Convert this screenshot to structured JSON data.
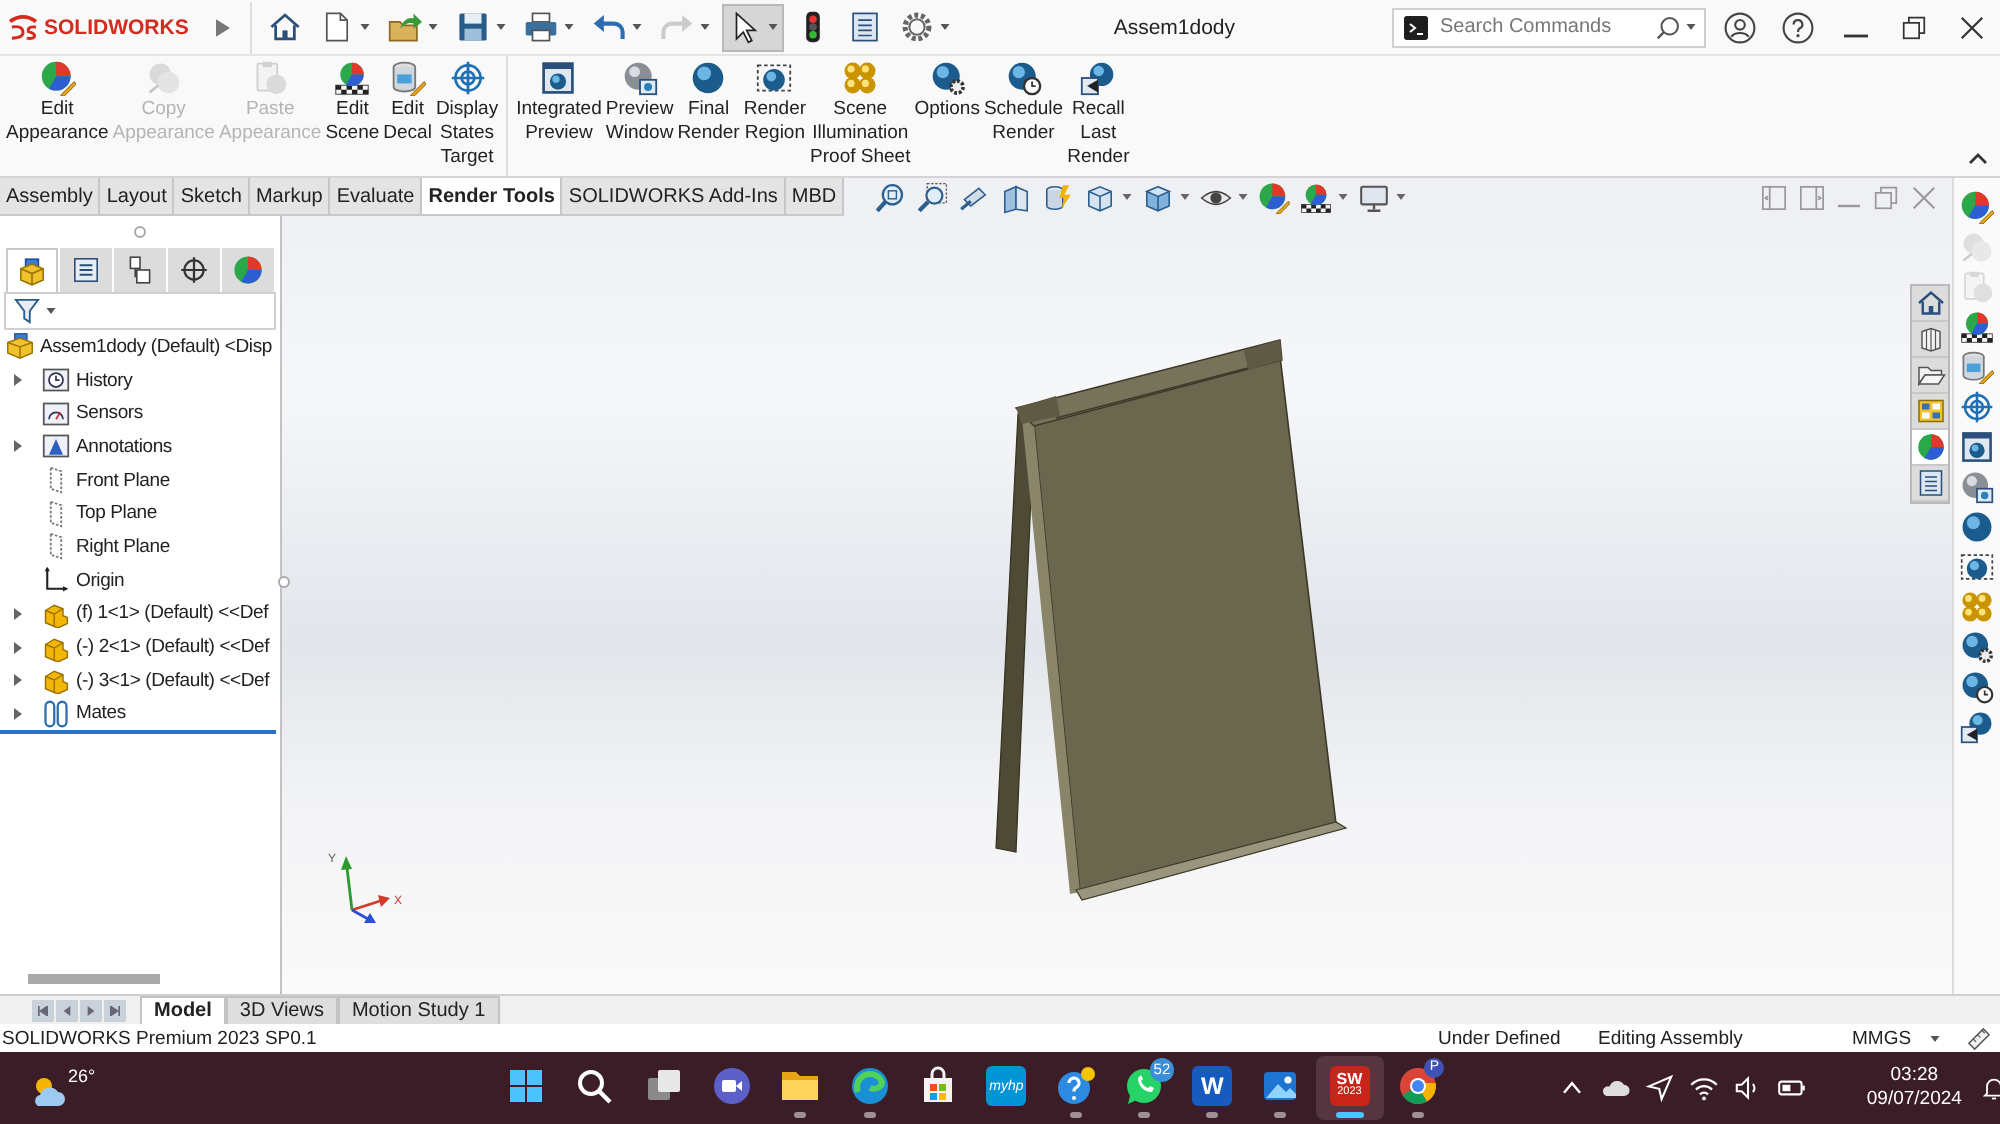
{
  "title_bar": {
    "logo": "SOLIDWORKS",
    "quick_access": [
      {
        "has_menu": false,
        "disabled": false,
        "selected": false
      },
      {
        "has_menu": true,
        "disabled": false,
        "selected": false
      },
      {
        "has_menu": true,
        "disabled": false,
        "selected": false
      },
      {
        "has_menu": true,
        "disabled": false,
        "selected": false
      },
      {
        "has_menu": true,
        "disabled": false,
        "selected": false
      },
      {
        "has_menu": true,
        "disabled": false,
        "selected": false
      },
      {
        "has_menu": true,
        "disabled": true,
        "selected": false
      },
      {
        "has_menu": true,
        "disabled": false,
        "selected": true
      },
      {
        "has_menu": false,
        "disabled": false,
        "selected": false
      },
      {
        "has_menu": false,
        "disabled": false,
        "selected": false
      },
      {
        "has_menu": true,
        "disabled": false,
        "selected": false
      }
    ],
    "document_title": "Assem1dody",
    "search": {
      "placeholder": "Search Commands"
    }
  },
  "command_manager": {
    "groups": [
      [
        {
          "label": "Edit\nAppearance",
          "disabled": false
        },
        {
          "label": "Copy\nAppearance",
          "disabled": true
        },
        {
          "label": "Paste\nAppearance",
          "disabled": true
        },
        {
          "label": "Edit\nScene",
          "disabled": false
        },
        {
          "label": "Edit\nDecal",
          "disabled": false
        },
        {
          "label": "Display\nStates\nTarget",
          "disabled": false
        }
      ],
      [
        {
          "label": "Integrated\nPreview",
          "disabled": false
        },
        {
          "label": "Preview\nWindow",
          "disabled": false
        },
        {
          "label": "Final\nRender",
          "disabled": false
        },
        {
          "label": "Render\nRegion",
          "disabled": false
        },
        {
          "label": "Scene\nIllumination\nProof Sheet",
          "disabled": false
        },
        {
          "label": "Options",
          "disabled": false
        },
        {
          "label": "Schedule\nRender",
          "disabled": false
        },
        {
          "label": "Recall\nLast\nRender",
          "disabled": false
        }
      ]
    ]
  },
  "tabs": [
    {
      "label": "Assembly",
      "selected": false
    },
    {
      "label": "Layout",
      "selected": false
    },
    {
      "label": "Sketch",
      "selected": false
    },
    {
      "label": "Markup",
      "selected": false
    },
    {
      "label": "Evaluate",
      "selected": false
    },
    {
      "label": "Render Tools",
      "selected": true
    },
    {
      "label": "SOLIDWORKS Add-Ins",
      "selected": false
    },
    {
      "label": "MBD",
      "selected": false
    }
  ],
  "heads_up_toolbar": [
    {
      "has_menu": false
    },
    {
      "has_menu": false
    },
    {
      "has_menu": false
    },
    {
      "has_menu": false
    },
    {
      "has_menu": false
    },
    {
      "has_menu": true
    },
    {
      "has_menu": true
    },
    {
      "has_menu": true
    },
    {
      "has_menu": false
    },
    {
      "has_menu": true
    },
    {
      "has_menu": true
    }
  ],
  "feature_manager": {
    "panel_tabs": [
      {
        "selected": true
      },
      {
        "selected": false
      },
      {
        "selected": false
      },
      {
        "selected": false
      },
      {
        "selected": false
      }
    ],
    "tree": {
      "label": "Assem1dody (Default) <Disp",
      "kind": "assembly",
      "children": [
        {
          "label": "History",
          "kind": "history",
          "has_children": true
        },
        {
          "label": "Sensors",
          "kind": "sensors",
          "has_children": false
        },
        {
          "label": "Annotations",
          "kind": "annotations",
          "has_children": true
        },
        {
          "label": "Front Plane",
          "kind": "plane",
          "has_children": false
        },
        {
          "label": "Top Plane",
          "kind": "plane",
          "has_children": false
        },
        {
          "label": "Right Plane",
          "kind": "plane",
          "has_children": false
        },
        {
          "label": "Origin",
          "kind": "origin",
          "has_children": false
        },
        {
          "label": "(f) 1<1> (Default) <<Def",
          "kind": "component",
          "has_children": true
        },
        {
          "label": "(-) 2<1> (Default) <<Def",
          "kind": "component",
          "has_children": true
        },
        {
          "label": "(-) 3<1> (Default) <<Def",
          "kind": "component",
          "has_children": true
        },
        {
          "label": "Mates",
          "kind": "mates",
          "has_children": true
        }
      ]
    }
  },
  "graphics_area": {
    "triad": {
      "y_label": "Y",
      "x_label": "X"
    },
    "view_toolbar": [
      {
        "selected": false
      },
      {
        "selected": false
      },
      {
        "selected": false
      },
      {
        "selected": false
      },
      {
        "selected": true
      },
      {
        "selected": false
      }
    ],
    "task_toolbar": [
      {
        "disabled": false
      },
      {
        "disabled": true
      },
      {
        "disabled": true
      },
      {
        "disabled": false
      },
      {
        "disabled": false
      },
      {
        "disabled": false
      },
      {
        "disabled": false
      },
      {
        "disabled": false
      },
      {
        "disabled": false
      },
      {
        "disabled": false
      },
      {
        "disabled": false
      },
      {
        "disabled": false
      },
      {
        "disabled": false
      },
      {
        "disabled": false
      }
    ]
  },
  "bottom_tabs": [
    {
      "label": "Model",
      "selected": true
    },
    {
      "label": "3D Views",
      "selected": false
    },
    {
      "label": "Motion Study 1",
      "selected": false
    }
  ],
  "status_bar": {
    "product": "SOLIDWORKS Premium 2023 SP0.1",
    "definition": "Under Defined",
    "mode": "Editing Assembly",
    "units": "MMGS"
  },
  "taskbar": {
    "weather": "26°",
    "apps": [
      {
        "running": false,
        "active": false
      },
      {
        "running": false,
        "active": false
      },
      {
        "running": false,
        "active": false
      },
      {
        "running": false,
        "active": false
      },
      {
        "running": true,
        "active": false
      },
      {
        "running": true,
        "active": false
      },
      {
        "running": false,
        "active": false
      },
      {
        "running": false,
        "active": false,
        "label": "myhp"
      },
      {
        "running": true,
        "active": false
      },
      {
        "running": true,
        "active": false,
        "badge": "52"
      },
      {
        "running": true,
        "active": false,
        "label": "W"
      },
      {
        "running": true,
        "active": false
      },
      {
        "running": true,
        "active": true,
        "label": "SW",
        "sublabel": "2023"
      },
      {
        "running": true,
        "active": false,
        "badge": "P"
      }
    ],
    "clock": {
      "time": "03:28",
      "date": "09/07/2024"
    }
  }
}
